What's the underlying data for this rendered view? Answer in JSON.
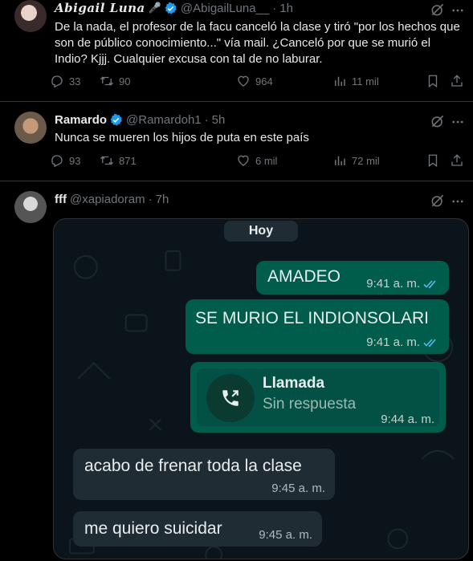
{
  "tweets": [
    {
      "name": "Abigail Luna",
      "badge_icon": "verified-badge-icon",
      "extra_icon": "🎤",
      "handle": "@AbigailLuna__",
      "sep": "·",
      "time": "1h",
      "text": "De la nada, el profesor de la facu canceló la clase y tiró \"por los hechos que son de público conocimiento...\" vía mail. ¿Canceló por que se murió el Indio? Kjjj. Cualquier excusa con tal de no laburar.",
      "replies": "33",
      "retweets": "90",
      "likes": "964",
      "views": "11 mil"
    },
    {
      "name": "Ramardo",
      "badge_icon": "verified-badge-icon",
      "handle": "@Ramardoh1",
      "sep": "·",
      "time": "5h",
      "text": "Nunca se mueren los hijos de puta en este país",
      "replies": "93",
      "retweets": "871",
      "likes": "6 mil",
      "views": "72 mil"
    },
    {
      "name": "fff",
      "handle": "@xapiadoram",
      "sep": "·",
      "time": "7h",
      "media": {
        "day_label": "Hoy",
        "messages": [
          {
            "direction": "out",
            "text": "AMADEO",
            "time": "9:41 a. m.",
            "status": "read"
          },
          {
            "direction": "out",
            "text": "SE MURIO EL INDIONSOLARI",
            "time": "9:41 a. m.",
            "status": "read"
          },
          {
            "direction": "out",
            "type": "call",
            "call_title": "Llamada",
            "call_sub": "Sin respuesta",
            "time": "9:44 a. m."
          },
          {
            "direction": "in",
            "text": "acabo de frenar toda la clase",
            "time": "9:45 a. m."
          },
          {
            "direction": "in",
            "text": "me quiero suicidar",
            "time": "9:45 a. m."
          }
        ]
      }
    }
  ],
  "colors": {
    "background": "#000000",
    "accent_verified": "#1d9bf0",
    "muted": "#71767b",
    "chat_out": "#005c4b",
    "chat_in": "#1f2c33",
    "read_ticks": "#53bdeb"
  }
}
